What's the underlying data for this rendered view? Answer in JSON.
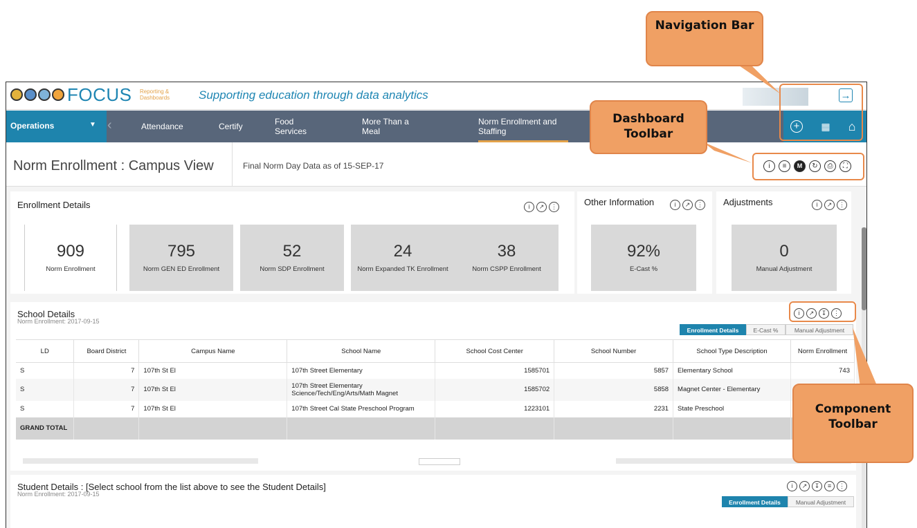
{
  "app": {
    "brand": "FOCUS",
    "brand_sub": "Reporting & Dashboards",
    "tagline": "Supporting education through data analytics"
  },
  "nav": {
    "ops_label": "Operations",
    "items": [
      "Attendance",
      "Certify",
      "Food Services",
      "More Than a Meal",
      "Norm Enrollment and Staffing"
    ]
  },
  "page": {
    "title": "Norm Enrollment : Campus View",
    "subtitle": "Final Norm Day Data as of 15-SEP-17"
  },
  "enrollment_details": {
    "title": "Enrollment Details",
    "metrics": [
      {
        "value": "909",
        "label": "Norm Enrollment"
      },
      {
        "value": "795",
        "label": "Norm GEN ED Enrollment"
      },
      {
        "value": "52",
        "label": "Norm SDP Enrollment"
      },
      {
        "value": "24",
        "label": "Norm Expanded TK Enrollment"
      },
      {
        "value": "38",
        "label": "Norm CSPP Enrollment"
      }
    ]
  },
  "other_info": {
    "title": "Other Information",
    "value": "92%",
    "label": "E-Cast %"
  },
  "adjustments": {
    "title": "Adjustments",
    "value": "0",
    "label": "Manual Adjustment"
  },
  "school_details": {
    "title": "School Details",
    "subtitle": "Norm Enrollment: 2017-09-15",
    "tabs": [
      "Enrollment Details",
      "E-Cast %",
      "Manual Adjustment"
    ],
    "columns": [
      "LD",
      "Board District",
      "Campus Name",
      "School Name",
      "School Cost Center",
      "School Number",
      "School Type Description",
      "Norm Enrollment"
    ],
    "rows": [
      [
        "S",
        "7",
        "107th St El",
        "107th Street Elementary",
        "1585701",
        "5857",
        "Elementary School",
        "743"
      ],
      [
        "S",
        "7",
        "107th St El",
        "107th Street Elementary Science/Tech/Eng/Arts/Math Magnet",
        "1585702",
        "5858",
        "Magnet Center - Elementary",
        ""
      ],
      [
        "S",
        "7",
        "107th St El",
        "107th Street Cal State Preschool Program",
        "1223101",
        "2231",
        "State Preschool",
        ""
      ]
    ],
    "total_label": "GRAND TOTAL"
  },
  "student_details": {
    "title": "Student Details : [Select school from the list above to see the Student Details]",
    "subtitle": "Norm Enrollment: 2017-09-15",
    "tabs": [
      "Enrollment Details",
      "Manual Adjustment"
    ]
  },
  "callouts": {
    "navigation": "Navigation Bar",
    "dashboard": "Dashboard Toolbar",
    "component": "Component Toolbar"
  },
  "colors": {
    "nav_bg": "#58667a",
    "accent": "#1e84ad",
    "callout": "#f0a064",
    "highlight_border": "#e8894a"
  },
  "icons": [
    "info-icon",
    "filter-icon",
    "m-icon",
    "refresh-icon",
    "print-icon",
    "fullscreen-icon",
    "expand-icon",
    "more-icon",
    "download-icon",
    "add-icon",
    "grid-icon",
    "home-icon",
    "logout-icon"
  ]
}
